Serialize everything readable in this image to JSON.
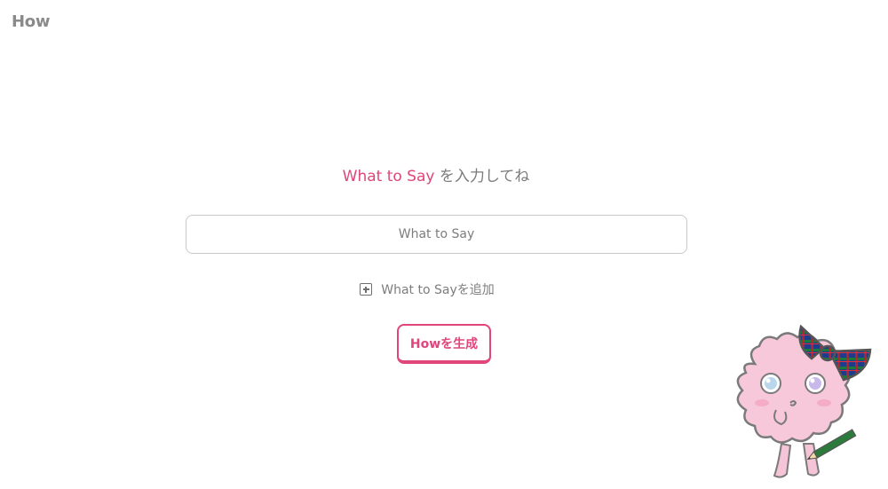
{
  "app": {
    "title": "How"
  },
  "main": {
    "heading_accent": "What to Say",
    "heading_rest": " を入力してね",
    "input": {
      "placeholder": "What to Say",
      "value": ""
    },
    "add_label": "What to Sayを追加",
    "generate_label": "Howを生成"
  },
  "colors": {
    "accent": "#e0457b",
    "text_gray": "#7d7d7d",
    "border": "#c9c9c9"
  },
  "icons": {
    "add": "plus-square-icon",
    "mascot": "pink-fluffy-mascot-illustration"
  }
}
